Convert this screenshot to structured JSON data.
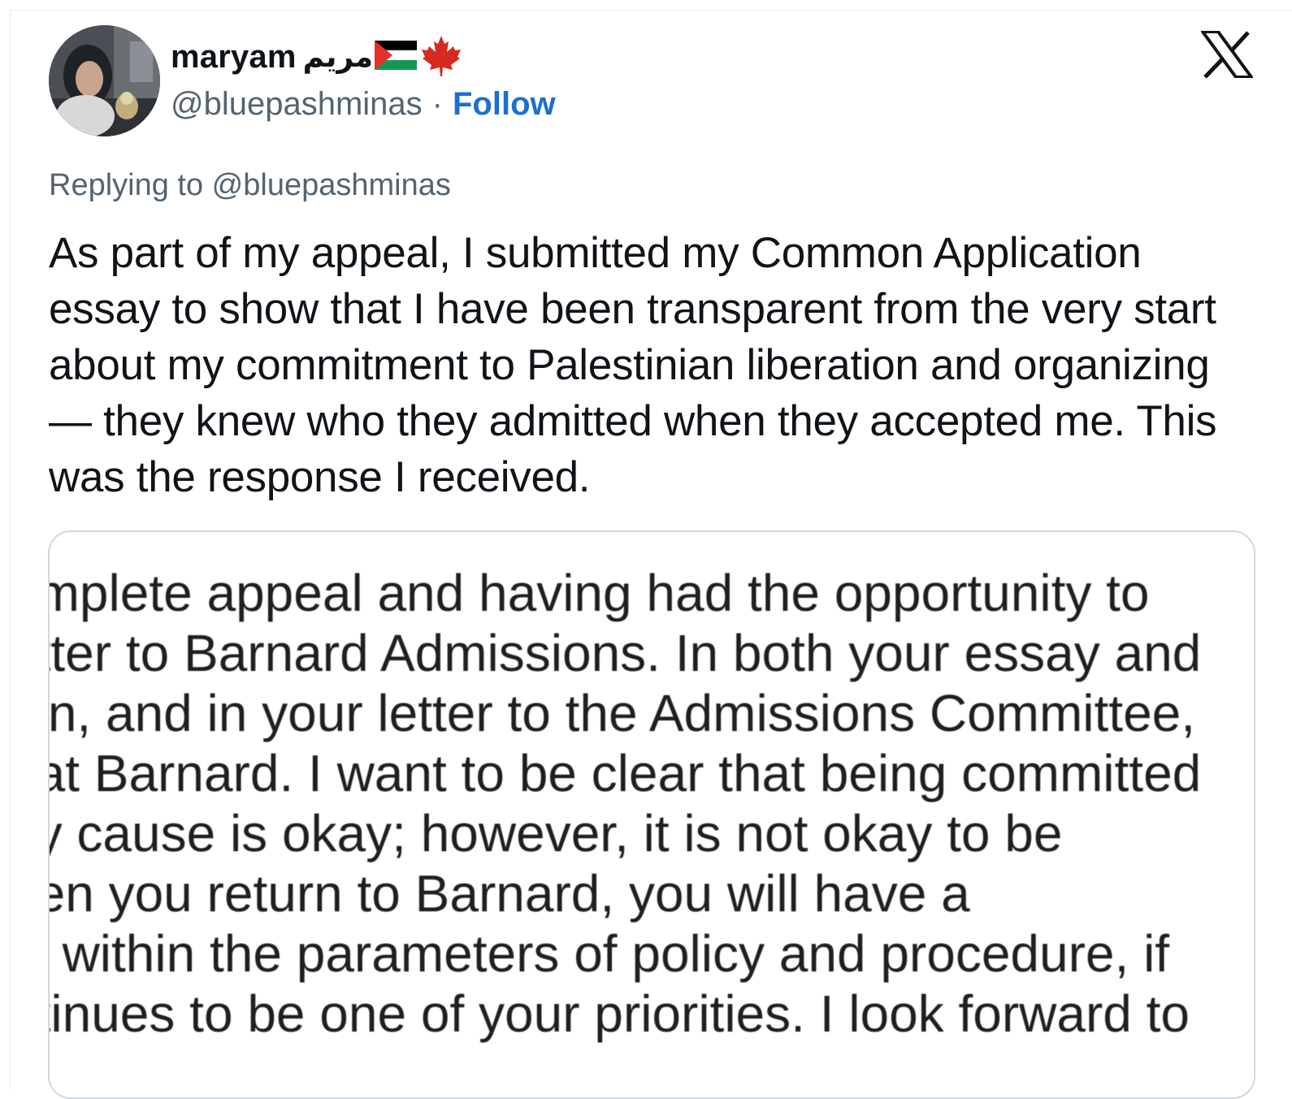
{
  "tweet": {
    "author": {
      "display_name": "maryam",
      "arabic_name": "مريم",
      "handle": "@bluepashminas",
      "separator": "·",
      "follow_label": "Follow"
    },
    "replying_to": "Replying to @bluepashminas",
    "text": "As part of my appeal, I submitted my Common Application essay to show that I have been transparent from the very start about my commitment to Palestinian liberation and organizing — they knew who they admitted when they accepted me. This was the response I received.",
    "media": {
      "lines": [
        "omplete appeal and having had the opportunity to",
        "etter to Barnard Admissions. In both your essay and",
        "ain, and in your letter to the Admissions Committee,",
        "hat Barnard. I want to be clear that being committed",
        "ny cause is okay; however, it is not okay to be",
        "hen you return to Barnard, you will have a",
        "s, within the parameters of policy and procedure, if",
        "ntinues to be one of your priorities. I look forward to"
      ]
    }
  },
  "icons": {
    "flag": "palestine-flag-icon",
    "maple": "maple-leaf-icon",
    "platform": "x-logo-icon"
  },
  "colors": {
    "text": "#0f1419",
    "secondary": "#536471",
    "link": "#1d6fcf",
    "border": "#cfd9de",
    "flag_red": "#e4312b",
    "flag_green": "#149954",
    "maple_red": "#d52b1e"
  }
}
